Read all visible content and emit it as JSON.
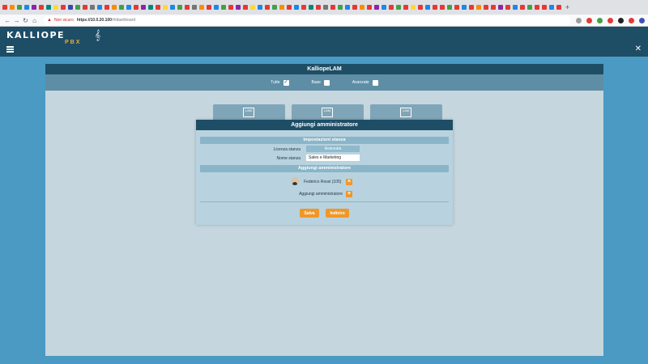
{
  "browser": {
    "tab_favicon_colors": [
      "#e53935",
      "#fb8c00",
      "#43a047",
      "#1e88e5",
      "#8e24aa",
      "#e53935",
      "#00897b",
      "#fdd835",
      "#e53935",
      "#3949ab",
      "#43a047",
      "#e53935",
      "#757575",
      "#1e88e5",
      "#e53935",
      "#fb8c00",
      "#43a047",
      "#1e88e5",
      "#e53935",
      "#8e24aa",
      "#00897b",
      "#e53935",
      "#fdd835",
      "#1e88e5",
      "#43a047",
      "#e53935",
      "#757575",
      "#fb8c00",
      "#e53935",
      "#1e88e5",
      "#43a047",
      "#e53935",
      "#8e24aa",
      "#e53935",
      "#fdd835",
      "#1e88e5",
      "#e53935",
      "#43a047",
      "#fb8c00",
      "#e53935",
      "#1e88e5",
      "#e53935",
      "#00897b",
      "#e53935",
      "#757575",
      "#e53935",
      "#43a047",
      "#1e88e5",
      "#e53935",
      "#fb8c00",
      "#e53935",
      "#8e24aa",
      "#1e88e5",
      "#e53935",
      "#43a047",
      "#e53935",
      "#fdd835",
      "#e53935",
      "#1e88e5",
      "#e53935",
      "#e53935",
      "#43a047",
      "#e53935",
      "#1e88e5",
      "#e53935",
      "#fb8c00",
      "#e53935",
      "#e53935",
      "#8e24aa",
      "#e53935",
      "#1e88e5",
      "#e53935",
      "#43a047",
      "#e53935",
      "#e53935",
      "#1e88e5",
      "#e53935"
    ],
    "not_secure_label": "Non sicuro",
    "url_host": "https://10.0.20.100",
    "url_path": "/#/dashboard",
    "extension_colors": [
      "#9e9e9e",
      "#e53935",
      "#43a047",
      "#e53935",
      "#212121",
      "#e53935",
      "#3f51b5"
    ]
  },
  "app": {
    "logo_text": "KALLIOPE",
    "logo_sub": "PBX"
  },
  "panel": {
    "title": "KalliopeLAM",
    "filters": [
      {
        "label": "Tutte",
        "checked": true
      },
      {
        "label": "Base",
        "checked": false
      },
      {
        "label": "Avanzate",
        "checked": false
      }
    ],
    "card_icon_text": "LAM"
  },
  "dialog": {
    "title": "Aggiungi amministratore",
    "section_room": "Impostazioni stanza",
    "license_label": "Licenza stanza",
    "license_value": "Avanzata",
    "name_label": "Nome stanza",
    "name_value": "Sales e Marketing",
    "section_admin": "Aggiungi amministratore",
    "admin_user": "Federico Rossi (105)",
    "add_admin_label": "Aggiungi amministratore",
    "save_label": "Salva",
    "back_label": "Indietro"
  },
  "colors": {
    "header_dark": "#1e4d66",
    "accent_orange": "#f0972a",
    "background": "#4a9ac4"
  }
}
